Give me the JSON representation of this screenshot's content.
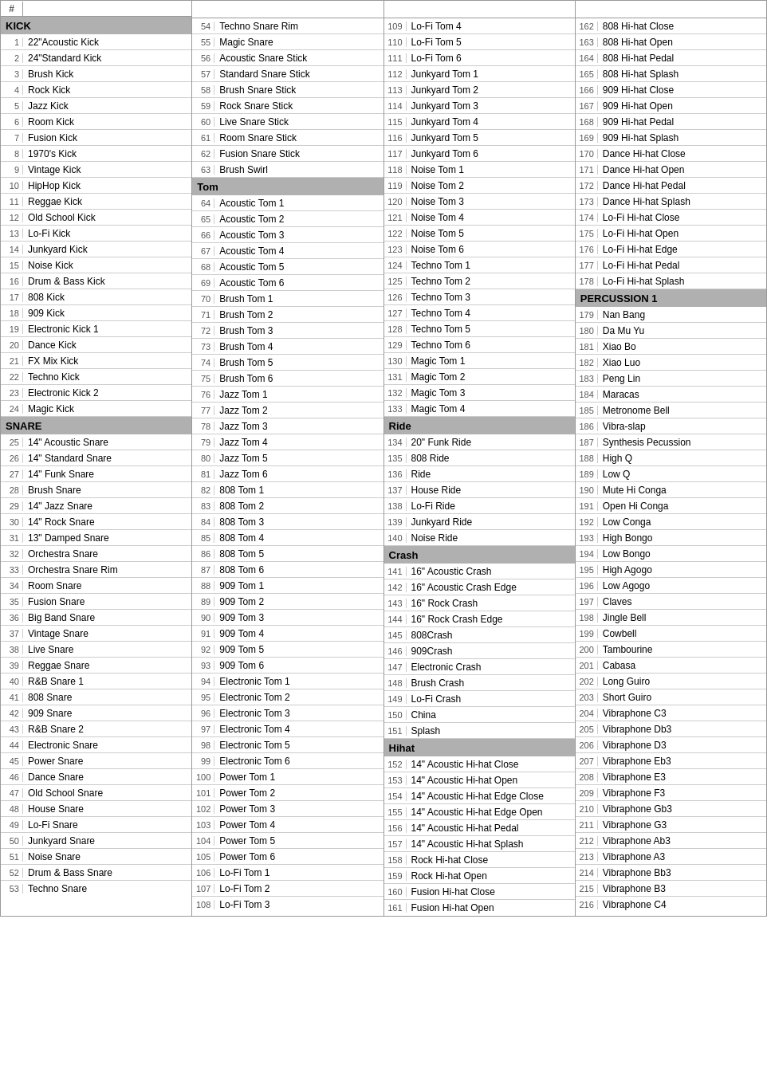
{
  "columns": [
    {
      "id": "col1",
      "header": {
        "num": "#",
        "name": ""
      },
      "sections": [
        {
          "type": "header",
          "label": "KICK"
        },
        {
          "num": "1",
          "name": "22\"Acoustic Kick"
        },
        {
          "num": "2",
          "name": "24\"Standard Kick"
        },
        {
          "num": "3",
          "name": "Brush Kick"
        },
        {
          "num": "4",
          "name": "Rock Kick"
        },
        {
          "num": "5",
          "name": "Jazz Kick"
        },
        {
          "num": "6",
          "name": "Room Kick"
        },
        {
          "num": "7",
          "name": "Fusion Kick"
        },
        {
          "num": "8",
          "name": "1970's Kick"
        },
        {
          "num": "9",
          "name": "Vintage Kick"
        },
        {
          "num": "10",
          "name": "HipHop  Kick"
        },
        {
          "num": "11",
          "name": "Reggae Kick"
        },
        {
          "num": "12",
          "name": "Old School Kick"
        },
        {
          "num": "13",
          "name": "Lo-Fi Kick"
        },
        {
          "num": "14",
          "name": "Junkyard Kick"
        },
        {
          "num": "15",
          "name": "Noise Kick"
        },
        {
          "num": "16",
          "name": "Drum & Bass Kick"
        },
        {
          "num": "17",
          "name": "808 Kick"
        },
        {
          "num": "18",
          "name": "909 Kick"
        },
        {
          "num": "19",
          "name": "Electronic Kick 1"
        },
        {
          "num": "20",
          "name": "Dance Kick"
        },
        {
          "num": "21",
          "name": "FX Mix Kick"
        },
        {
          "num": "22",
          "name": "Techno Kick"
        },
        {
          "num": "23",
          "name": "Electronic Kick 2"
        },
        {
          "num": "24",
          "name": "Magic Kick"
        },
        {
          "type": "header",
          "label": "SNARE"
        },
        {
          "num": "25",
          "name": "14\" Acoustic Snare"
        },
        {
          "num": "26",
          "name": "14\" Standard Snare"
        },
        {
          "num": "27",
          "name": "14\" Funk Snare"
        },
        {
          "num": "28",
          "name": "Brush Snare"
        },
        {
          "num": "29",
          "name": "14\" Jazz Snare"
        },
        {
          "num": "30",
          "name": "14\" Rock Snare"
        },
        {
          "num": "31",
          "name": "13\" Damped Snare"
        },
        {
          "num": "32",
          "name": "Orchestra Snare"
        },
        {
          "num": "33",
          "name": "Orchestra Snare Rim"
        },
        {
          "num": "34",
          "name": "Room Snare"
        },
        {
          "num": "35",
          "name": "Fusion Snare"
        },
        {
          "num": "36",
          "name": "Big Band Snare"
        },
        {
          "num": "37",
          "name": "Vintage Snare"
        },
        {
          "num": "38",
          "name": "Live Snare"
        },
        {
          "num": "39",
          "name": "Reggae Snare"
        },
        {
          "num": "40",
          "name": "R&B Snare 1"
        },
        {
          "num": "41",
          "name": "808 Snare"
        },
        {
          "num": "42",
          "name": "909 Snare"
        },
        {
          "num": "43",
          "name": "R&B Snare 2"
        },
        {
          "num": "44",
          "name": "Electronic Snare"
        },
        {
          "num": "45",
          "name": "Power Snare"
        },
        {
          "num": "46",
          "name": "Dance Snare"
        },
        {
          "num": "47",
          "name": "Old School Snare"
        },
        {
          "num": "48",
          "name": "House Snare"
        },
        {
          "num": "49",
          "name": "Lo-Fi Snare"
        },
        {
          "num": "50",
          "name": "Junkyard Snare"
        },
        {
          "num": "51",
          "name": "Noise Snare"
        },
        {
          "num": "52",
          "name": "Drum & Bass Snare"
        },
        {
          "num": "53",
          "name": "Techno Snare"
        }
      ]
    },
    {
      "id": "col2",
      "header": {
        "num": "",
        "name": ""
      },
      "sections": [
        {
          "num": "54",
          "name": "Techno Snare Rim"
        },
        {
          "num": "55",
          "name": "Magic Snare"
        },
        {
          "num": "56",
          "name": "Acoustic Snare Stick"
        },
        {
          "num": "57",
          "name": "Standard Snare Stick"
        },
        {
          "num": "58",
          "name": "Brush Snare Stick"
        },
        {
          "num": "59",
          "name": "Rock Snare Stick"
        },
        {
          "num": "60",
          "name": "Live Snare Stick"
        },
        {
          "num": "61",
          "name": "Room Snare Stick"
        },
        {
          "num": "62",
          "name": "Fusion Snare Stick"
        },
        {
          "num": "63",
          "name": "Brush Swirl"
        },
        {
          "type": "header",
          "label": "Tom"
        },
        {
          "num": "64",
          "name": "Acoustic Tom 1"
        },
        {
          "num": "65",
          "name": "Acoustic Tom 2"
        },
        {
          "num": "66",
          "name": "Acoustic Tom 3"
        },
        {
          "num": "67",
          "name": "Acoustic Tom 4"
        },
        {
          "num": "68",
          "name": "Acoustic Tom 5"
        },
        {
          "num": "69",
          "name": "Acoustic Tom 6"
        },
        {
          "num": "70",
          "name": "Brush Tom 1"
        },
        {
          "num": "71",
          "name": "Brush Tom 2"
        },
        {
          "num": "72",
          "name": "Brush Tom 3"
        },
        {
          "num": "73",
          "name": "Brush Tom 4"
        },
        {
          "num": "74",
          "name": "Brush Tom 5"
        },
        {
          "num": "75",
          "name": "Brush Tom 6"
        },
        {
          "num": "76",
          "name": "Jazz Tom 1"
        },
        {
          "num": "77",
          "name": "Jazz Tom 2"
        },
        {
          "num": "78",
          "name": "Jazz Tom 3"
        },
        {
          "num": "79",
          "name": "Jazz Tom 4"
        },
        {
          "num": "80",
          "name": "Jazz Tom 5"
        },
        {
          "num": "81",
          "name": "Jazz Tom 6"
        },
        {
          "num": "82",
          "name": "808 Tom 1"
        },
        {
          "num": "83",
          "name": "808 Tom 2"
        },
        {
          "num": "84",
          "name": "808 Tom 3"
        },
        {
          "num": "85",
          "name": "808 Tom 4"
        },
        {
          "num": "86",
          "name": "808 Tom 5"
        },
        {
          "num": "87",
          "name": "808 Tom 6"
        },
        {
          "num": "88",
          "name": "909 Tom 1"
        },
        {
          "num": "89",
          "name": "909 Tom 2"
        },
        {
          "num": "90",
          "name": "909 Tom 3"
        },
        {
          "num": "91",
          "name": "909 Tom 4"
        },
        {
          "num": "92",
          "name": "909 Tom 5"
        },
        {
          "num": "93",
          "name": "909 Tom 6"
        },
        {
          "num": "94",
          "name": "Electronic Tom 1"
        },
        {
          "num": "95",
          "name": "Electronic Tom 2"
        },
        {
          "num": "96",
          "name": "Electronic Tom 3"
        },
        {
          "num": "97",
          "name": "Electronic Tom 4"
        },
        {
          "num": "98",
          "name": "Electronic Tom 5"
        },
        {
          "num": "99",
          "name": "Electronic Tom 6"
        },
        {
          "num": "100",
          "name": "Power Tom 1"
        },
        {
          "num": "101",
          "name": "Power Tom 2"
        },
        {
          "num": "102",
          "name": "Power Tom 3"
        },
        {
          "num": "103",
          "name": "Power Tom 4"
        },
        {
          "num": "104",
          "name": "Power Tom 5"
        },
        {
          "num": "105",
          "name": "Power Tom 6"
        },
        {
          "num": "106",
          "name": "Lo-Fi Tom 1"
        },
        {
          "num": "107",
          "name": "Lo-Fi Tom 2"
        },
        {
          "num": "108",
          "name": "Lo-Fi Tom 3"
        }
      ]
    },
    {
      "id": "col3",
      "header": {
        "num": "",
        "name": ""
      },
      "sections": [
        {
          "num": "109",
          "name": "Lo-Fi Tom 4"
        },
        {
          "num": "110",
          "name": "Lo-Fi Tom 5"
        },
        {
          "num": "111",
          "name": "Lo-Fi Tom 6"
        },
        {
          "num": "112",
          "name": "Junkyard Tom 1"
        },
        {
          "num": "113",
          "name": "Junkyard Tom 2"
        },
        {
          "num": "114",
          "name": "Junkyard Tom 3"
        },
        {
          "num": "115",
          "name": "Junkyard Tom 4"
        },
        {
          "num": "116",
          "name": "Junkyard Tom 5"
        },
        {
          "num": "117",
          "name": "Junkyard Tom 6"
        },
        {
          "num": "118",
          "name": "Noise Tom 1"
        },
        {
          "num": "119",
          "name": "Noise Tom 2"
        },
        {
          "num": "120",
          "name": "Noise Tom 3"
        },
        {
          "num": "121",
          "name": "Noise Tom 4"
        },
        {
          "num": "122",
          "name": "Noise Tom 5"
        },
        {
          "num": "123",
          "name": "Noise Tom 6"
        },
        {
          "num": "124",
          "name": "Techno Tom 1"
        },
        {
          "num": "125",
          "name": "Techno Tom 2"
        },
        {
          "num": "126",
          "name": "Techno Tom 3"
        },
        {
          "num": "127",
          "name": "Techno Tom 4"
        },
        {
          "num": "128",
          "name": "Techno Tom 5"
        },
        {
          "num": "129",
          "name": "Techno Tom 6"
        },
        {
          "num": "130",
          "name": "Magic Tom 1"
        },
        {
          "num": "131",
          "name": "Magic Tom 2"
        },
        {
          "num": "132",
          "name": "Magic Tom 3"
        },
        {
          "num": "133",
          "name": "Magic Tom 4"
        },
        {
          "type": "header",
          "label": "Ride"
        },
        {
          "num": "134",
          "name": "20\"  Funk Ride"
        },
        {
          "num": "135",
          "name": "808 Ride"
        },
        {
          "num": "136",
          "name": "Ride"
        },
        {
          "num": "137",
          "name": "House Ride"
        },
        {
          "num": "138",
          "name": "Lo-Fi Ride"
        },
        {
          "num": "139",
          "name": "Junkyard Ride"
        },
        {
          "num": "140",
          "name": "Noise Ride"
        },
        {
          "type": "header",
          "label": "Crash"
        },
        {
          "num": "141",
          "name": "16\" Acoustic Crash"
        },
        {
          "num": "142",
          "name": "16\" Acoustic Crash Edge"
        },
        {
          "num": "143",
          "name": "16\" Rock Crash"
        },
        {
          "num": "144",
          "name": "16\" Rock Crash Edge"
        },
        {
          "num": "145",
          "name": "808Crash"
        },
        {
          "num": "146",
          "name": "909Crash"
        },
        {
          "num": "147",
          "name": "Electronic Crash"
        },
        {
          "num": "148",
          "name": "Brush Crash"
        },
        {
          "num": "149",
          "name": "Lo-Fi Crash"
        },
        {
          "num": "150",
          "name": "China"
        },
        {
          "num": "151",
          "name": "Splash"
        },
        {
          "type": "header",
          "label": "Hihat"
        },
        {
          "num": "152",
          "name": "14\"  Acoustic Hi-hat Close"
        },
        {
          "num": "153",
          "name": "14\" Acoustic Hi-hat Open"
        },
        {
          "num": "154",
          "name": "14\" Acoustic Hi-hat Edge Close"
        },
        {
          "num": "155",
          "name": "14\" Acoustic Hi-hat Edge Open"
        },
        {
          "num": "156",
          "name": "14\" Acoustic Hi-hat Pedal"
        },
        {
          "num": "157",
          "name": "14\" Acoustic Hi-hat Splash"
        },
        {
          "num": "158",
          "name": "Rock Hi-hat Close"
        },
        {
          "num": "159",
          "name": "Rock Hi-hat Open"
        },
        {
          "num": "160",
          "name": "Fusion Hi-hat Close"
        },
        {
          "num": "161",
          "name": "Fusion Hi-hat Open"
        }
      ]
    },
    {
      "id": "col4",
      "header": {
        "num": "",
        "name": ""
      },
      "sections": [
        {
          "num": "162",
          "name": "808 Hi-hat Close"
        },
        {
          "num": "163",
          "name": "808 Hi-hat Open"
        },
        {
          "num": "164",
          "name": "808 Hi-hat Pedal"
        },
        {
          "num": "165",
          "name": "808 Hi-hat Splash"
        },
        {
          "num": "166",
          "name": "909 Hi-hat Close"
        },
        {
          "num": "167",
          "name": "909 Hi-hat Open"
        },
        {
          "num": "168",
          "name": "909 Hi-hat Pedal"
        },
        {
          "num": "169",
          "name": "909 Hi-hat Splash"
        },
        {
          "num": "170",
          "name": "Dance Hi-hat Close"
        },
        {
          "num": "171",
          "name": "Dance Hi-hat Open"
        },
        {
          "num": "172",
          "name": "Dance Hi-hat Pedal"
        },
        {
          "num": "173",
          "name": "Dance Hi-hat Splash"
        },
        {
          "num": "174",
          "name": "Lo-Fi Hi-hat Close"
        },
        {
          "num": "175",
          "name": "Lo-Fi Hi-hat Open"
        },
        {
          "num": "176",
          "name": "Lo-Fi Hi-hat Edge"
        },
        {
          "num": "177",
          "name": "Lo-Fi Hi-hat Pedal"
        },
        {
          "num": "178",
          "name": "Lo-Fi Hi-hat Splash"
        },
        {
          "type": "header",
          "label": "PERCUSSION 1"
        },
        {
          "num": "179",
          "name": "Nan Bang"
        },
        {
          "num": "180",
          "name": "Da Mu Yu"
        },
        {
          "num": "181",
          "name": "Xiao Bo"
        },
        {
          "num": "182",
          "name": "Xiao Luo"
        },
        {
          "num": "183",
          "name": "Peng Lin"
        },
        {
          "num": "184",
          "name": "Maracas"
        },
        {
          "num": "185",
          "name": "Metronome Bell"
        },
        {
          "num": "186",
          "name": "Vibra-slap"
        },
        {
          "num": "187",
          "name": "Synthesis Pecussion"
        },
        {
          "num": "188",
          "name": "High Q"
        },
        {
          "num": "189",
          "name": "Low Q"
        },
        {
          "num": "190",
          "name": "Mute Hi Conga"
        },
        {
          "num": "191",
          "name": "Open Hi Conga"
        },
        {
          "num": "192",
          "name": "Low Conga"
        },
        {
          "num": "193",
          "name": "High Bongo"
        },
        {
          "num": "194",
          "name": "Low Bongo"
        },
        {
          "num": "195",
          "name": "High Agogo"
        },
        {
          "num": "196",
          "name": "Low Agogo"
        },
        {
          "num": "197",
          "name": "Claves"
        },
        {
          "num": "198",
          "name": "Jingle Bell"
        },
        {
          "num": "199",
          "name": "Cowbell"
        },
        {
          "num": "200",
          "name": "Tambourine"
        },
        {
          "num": "201",
          "name": "Cabasa"
        },
        {
          "num": "202",
          "name": "Long Guiro"
        },
        {
          "num": "203",
          "name": "Short Guiro"
        },
        {
          "num": "204",
          "name": "Vibraphone C3"
        },
        {
          "num": "205",
          "name": "Vibraphone Db3"
        },
        {
          "num": "206",
          "name": "Vibraphone D3"
        },
        {
          "num": "207",
          "name": "Vibraphone Eb3"
        },
        {
          "num": "208",
          "name": "Vibraphone E3"
        },
        {
          "num": "209",
          "name": "Vibraphone F3"
        },
        {
          "num": "210",
          "name": "Vibraphone Gb3"
        },
        {
          "num": "211",
          "name": "Vibraphone G3"
        },
        {
          "num": "212",
          "name": "Vibraphone Ab3"
        },
        {
          "num": "213",
          "name": "Vibraphone A3"
        },
        {
          "num": "214",
          "name": "Vibraphone Bb3"
        },
        {
          "num": "215",
          "name": "Vibraphone B3"
        },
        {
          "num": "216",
          "name": "Vibraphone C4"
        }
      ]
    }
  ]
}
